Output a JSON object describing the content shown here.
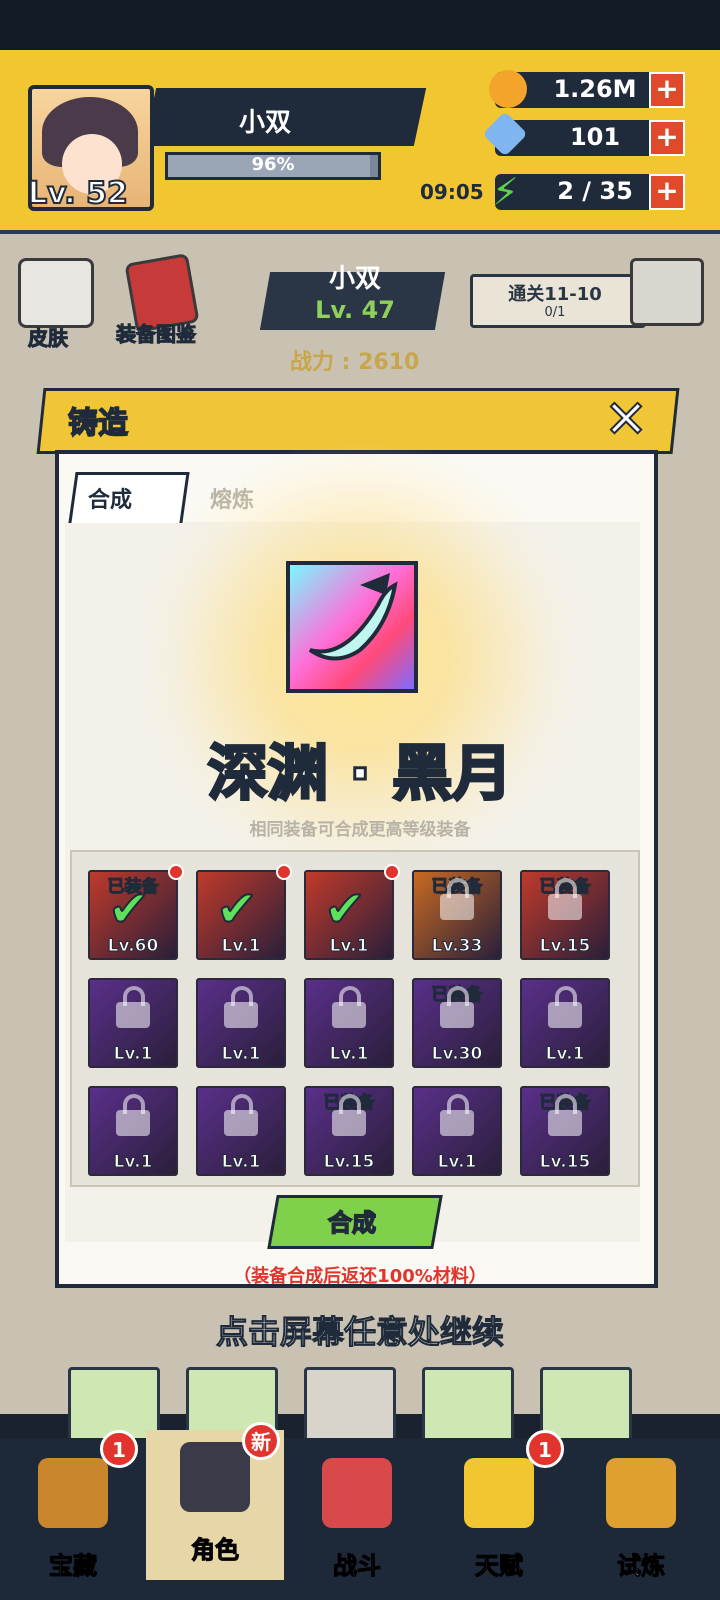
{
  "header": {
    "player_name": "小双",
    "player_level": "Lv. 52",
    "exp_percent_text": "96%",
    "exp_fraction": 0.96,
    "gold": "1.26M",
    "gems": "101",
    "energy_timer": "09:05",
    "energy": "2 / 35",
    "plus": "+"
  },
  "character": {
    "skin_label": "皮肤",
    "codex_label": "装备图鉴",
    "name": "小双",
    "level": "Lv. 47",
    "power": "战力 : 2610",
    "stage": "通关11-10",
    "stage_progress": "0/1"
  },
  "forge": {
    "title": "铸造",
    "close": "✕",
    "tab_synthesize": "合成",
    "tab_smelt": "熔炼",
    "item_name": "深渊 · 黑月",
    "hint": "相同装备可合成更高等级装备",
    "slots": [
      {
        "level": "Lv.60",
        "equipped": "已装备",
        "checked": true,
        "dot": true,
        "color": "#c03a2a"
      },
      {
        "level": "Lv.1",
        "equipped": "",
        "checked": true,
        "dot": true,
        "color": "#c03a2a"
      },
      {
        "level": "Lv.1",
        "equipped": "",
        "checked": true,
        "dot": true,
        "color": "#c03a2a"
      },
      {
        "level": "Lv.33",
        "equipped": "已装备",
        "checked": false,
        "dot": false,
        "color": "#c86a22"
      },
      {
        "level": "Lv.15",
        "equipped": "已装备",
        "checked": false,
        "dot": false,
        "color": "#c03a2a"
      },
      {
        "level": "Lv.1",
        "equipped": "",
        "checked": false,
        "dot": false,
        "color": "#5a2f8a"
      },
      {
        "level": "Lv.1",
        "equipped": "",
        "checked": false,
        "dot": false,
        "color": "#5a2f8a"
      },
      {
        "level": "Lv.1",
        "equipped": "",
        "checked": false,
        "dot": false,
        "color": "#5a2f8a"
      },
      {
        "level": "Lv.30",
        "equipped": "已装备",
        "checked": false,
        "dot": false,
        "color": "#5a2f8a"
      },
      {
        "level": "Lv.1",
        "equipped": "",
        "checked": false,
        "dot": false,
        "color": "#5a2f8a"
      },
      {
        "level": "Lv.1",
        "equipped": "",
        "checked": false,
        "dot": false,
        "color": "#5a2f8a"
      },
      {
        "level": "Lv.1",
        "equipped": "",
        "checked": false,
        "dot": false,
        "color": "#5a2f8a"
      },
      {
        "level": "Lv.15",
        "equipped": "已装备",
        "checked": false,
        "dot": false,
        "color": "#5a2f8a"
      },
      {
        "level": "Lv.1",
        "equipped": "",
        "checked": false,
        "dot": false,
        "color": "#5a2f8a"
      },
      {
        "level": "Lv.15",
        "equipped": "已装备",
        "checked": false,
        "dot": false,
        "color": "#5a2f8a"
      }
    ],
    "synthesize_button": "合成",
    "refund_note": "（装备合成后返还100%材料）",
    "tap_continue": "点击屏幕任意处继续"
  },
  "nav": [
    {
      "label": "宝藏",
      "badge": "1",
      "icon": "treasure-chest-icon"
    },
    {
      "label": "角色",
      "badge": "新",
      "icon": "character-icon"
    },
    {
      "label": "战斗",
      "badge": "",
      "icon": "battle-icon"
    },
    {
      "label": "天赋",
      "badge": "1",
      "icon": "talent-bulb-icon"
    },
    {
      "label": "试炼",
      "badge": "",
      "icon": "trial-icon"
    }
  ],
  "colors": {
    "accent_yellow": "#f2c631",
    "navy": "#1f2a3a",
    "confirm_green": "#7fd04a",
    "alert_red": "#e0342c"
  }
}
